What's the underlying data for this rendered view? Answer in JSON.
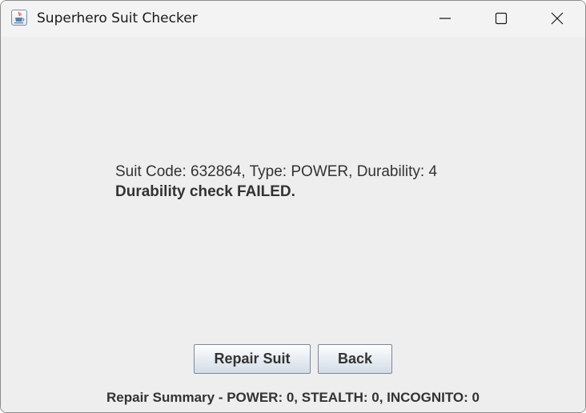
{
  "window": {
    "title": "Superhero Suit Checker",
    "icon": "java-cup-icon",
    "controls": [
      "minimize-icon",
      "maximize-icon",
      "close-icon"
    ]
  },
  "main": {
    "suit_info": "Suit Code: 632864, Type: POWER, Durability: 4",
    "check_result": "Durability check FAILED."
  },
  "buttons": {
    "repair_label": "Repair Suit",
    "back_label": "Back"
  },
  "summary": {
    "text": "Repair Summary - POWER: 0, STEALTH: 0, INCOGNITO: 0"
  },
  "colors": {
    "background": "#eeeeee",
    "titlebar": "#f3f3f3",
    "text": "#333333"
  }
}
